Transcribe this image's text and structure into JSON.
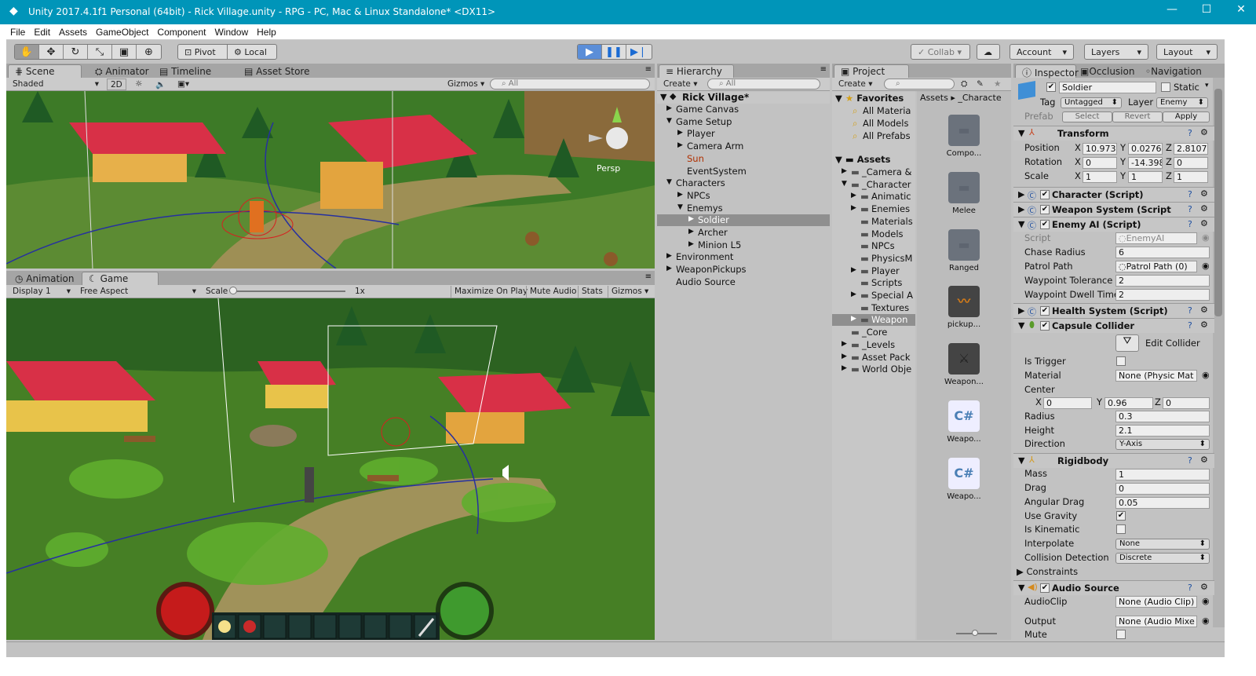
{
  "window": {
    "title": "Unity 2017.4.1f1 Personal (64bit) - Rick Village.unity - RPG - PC, Mac & Linux Standalone* <DX11>"
  },
  "menu": [
    "File",
    "Edit",
    "Assets",
    "GameObject",
    "Component",
    "Window",
    "Help"
  ],
  "toolbar": {
    "pivot": "Pivot",
    "local": "Local",
    "collab": "Collab ▾",
    "account": "Account",
    "layers": "Layers",
    "layout": "Layout"
  },
  "scene": {
    "tabs": [
      "Scene",
      "Animator",
      "Timeline",
      "Asset Store"
    ],
    "shading": "Shaded",
    "mode2d": "2D",
    "gizmos": "Gizmos ▾",
    "search_placeholder": "All",
    "persp": "Persp"
  },
  "game": {
    "tabs": [
      "Animation",
      "Game"
    ],
    "display": "Display 1",
    "aspect": "Free Aspect",
    "scale_label": "Scale",
    "scale_value": "1x",
    "maximize": "Maximize On Play",
    "mute": "Mute Audio",
    "stats": "Stats",
    "gizmos": "Gizmos"
  },
  "hierarchy": {
    "tab": "Hierarchy",
    "create": "Create ▾",
    "search_placeholder": "All",
    "scene_name": "Rick Village*",
    "items": [
      {
        "label": "Game Canvas",
        "indent": 1,
        "arrow": "▶"
      },
      {
        "label": "Game Setup",
        "indent": 1,
        "arrow": "▼"
      },
      {
        "label": "Player",
        "indent": 2,
        "arrow": "▶"
      },
      {
        "label": "Camera Arm",
        "indent": 2,
        "arrow": "▶"
      },
      {
        "label": "Sun",
        "indent": 2,
        "arrow": ""
      },
      {
        "label": "EventSystem",
        "indent": 2,
        "arrow": ""
      },
      {
        "label": "Characters",
        "indent": 1,
        "arrow": "▼"
      },
      {
        "label": "NPCs",
        "indent": 2,
        "arrow": "▶"
      },
      {
        "label": "Enemys",
        "indent": 2,
        "arrow": "▼"
      },
      {
        "label": "Soldier",
        "indent": 3,
        "arrow": "▶"
      },
      {
        "label": "Archer",
        "indent": 3,
        "arrow": "▶"
      },
      {
        "label": "Minion L5",
        "indent": 3,
        "arrow": "▶"
      },
      {
        "label": "Environment",
        "indent": 1,
        "arrow": "▶"
      },
      {
        "label": "WeaponPickups",
        "indent": 1,
        "arrow": "▶"
      },
      {
        "label": "Audio Source",
        "indent": 1,
        "arrow": ""
      }
    ]
  },
  "project": {
    "tab": "Project",
    "create": "Create ▾",
    "favorites_title": "Favorites",
    "favorites": [
      "All Materia",
      "All Models",
      "All Prefabs"
    ],
    "assets_title": "Assets",
    "tree": [
      {
        "label": "_Camera &",
        "indent": 1,
        "arrow": "▶"
      },
      {
        "label": "_Character",
        "indent": 1,
        "arrow": "▼"
      },
      {
        "label": "Animatic",
        "indent": 2,
        "arrow": "▶"
      },
      {
        "label": "Enemies",
        "indent": 2,
        "arrow": "▶"
      },
      {
        "label": "Materials",
        "indent": 2,
        "arrow": ""
      },
      {
        "label": "Models",
        "indent": 2,
        "arrow": ""
      },
      {
        "label": "NPCs",
        "indent": 2,
        "arrow": ""
      },
      {
        "label": "PhysicsM",
        "indent": 2,
        "arrow": ""
      },
      {
        "label": "Player",
        "indent": 2,
        "arrow": "▶"
      },
      {
        "label": "Scripts",
        "indent": 2,
        "arrow": ""
      },
      {
        "label": "Special A",
        "indent": 2,
        "arrow": "▶"
      },
      {
        "label": "Textures",
        "indent": 2,
        "arrow": ""
      },
      {
        "label": "Weapon",
        "indent": 2,
        "arrow": "▶"
      },
      {
        "label": "_Core",
        "indent": 1,
        "arrow": ""
      },
      {
        "label": "_Levels",
        "indent": 1,
        "arrow": "▶"
      },
      {
        "label": "Asset Pack",
        "indent": 1,
        "arrow": "▶"
      },
      {
        "label": "World Obje",
        "indent": 1,
        "arrow": "▶"
      }
    ],
    "breadcrumb": [
      "Assets",
      "_Characte"
    ],
    "grid": [
      {
        "label": "Compo...",
        "kind": "folder"
      },
      {
        "label": "Melee",
        "kind": "folder"
      },
      {
        "label": "Ranged",
        "kind": "folder"
      },
      {
        "label": "pickup...",
        "kind": "audio"
      },
      {
        "label": "Weapon...",
        "kind": "prefab"
      },
      {
        "label": "Weapo...",
        "kind": "script"
      },
      {
        "label": "Weapo...",
        "kind": "script"
      }
    ]
  },
  "inspector": {
    "tabs": [
      "Inspector",
      "Occlusion",
      "Navigation"
    ],
    "object_name": "Soldier",
    "static_label": "Static",
    "tag_label": "Tag",
    "tag_value": "Untagged",
    "layer_label": "Layer",
    "layer_value": "Enemy",
    "prefab_label": "Prefab",
    "prefab_select": "Select",
    "prefab_revert": "Revert",
    "prefab_apply": "Apply",
    "transform": {
      "title": "Transform",
      "position": {
        "label": "Position",
        "x": "10.973",
        "y": "0.0276",
        "z": "2.8107"
      },
      "rotation": {
        "label": "Rotation",
        "x": "0",
        "y": "-14.398",
        "z": "0"
      },
      "scale": {
        "label": "Scale",
        "x": "1",
        "y": "1",
        "z": "1"
      }
    },
    "character_script": "Character (Script)",
    "weapon_system": "Weapon System (Script",
    "enemy_ai": {
      "title": "Enemy AI (Script)",
      "script_label": "Script",
      "script_value": "EnemyAI",
      "chase_label": "Chase Radius",
      "chase_value": "6",
      "patrol_label": "Patrol Path",
      "patrol_value": "Patrol Path (0)",
      "tol_label": "Waypoint Tolerance",
      "tol_value": "2",
      "dwell_label": "Waypoint Dwell Time",
      "dwell_value": "2"
    },
    "health_system": "Health System (Script)",
    "capsule": {
      "title": "Capsule Collider",
      "edit": "Edit Collider",
      "trigger_label": "Is Trigger",
      "material_label": "Material",
      "material_value": "None (Physic Mat",
      "center_label": "Center",
      "cx": "0",
      "cy": "0.96",
      "cz": "0",
      "radius_label": "Radius",
      "radius_value": "0.3",
      "height_label": "Height",
      "height_value": "2.1",
      "direction_label": "Direction",
      "direction_value": "Y-Axis"
    },
    "rigidbody": {
      "title": "Rigidbody",
      "mass_label": "Mass",
      "mass_value": "1",
      "drag_label": "Drag",
      "drag_value": "0",
      "adrag_label": "Angular Drag",
      "adrag_value": "0.05",
      "gravity_label": "Use Gravity",
      "kinematic_label": "Is Kinematic",
      "interp_label": "Interpolate",
      "interp_value": "None",
      "coll_label": "Collision Detection",
      "coll_value": "Discrete",
      "constraints_label": "Constraints"
    },
    "audio": {
      "title": "Audio Source",
      "clip_label": "AudioClip",
      "clip_value": "None (Audio Clip)",
      "output_label": "Output",
      "output_value": "None (Audio Mixe",
      "mute_label": "Mute"
    }
  },
  "colors": {
    "titlebar": "#0095b9",
    "panel": "#c2c2c2",
    "selection": "#8f8f8f",
    "grass": "#3e7a22",
    "roof": "#d8304a"
  }
}
